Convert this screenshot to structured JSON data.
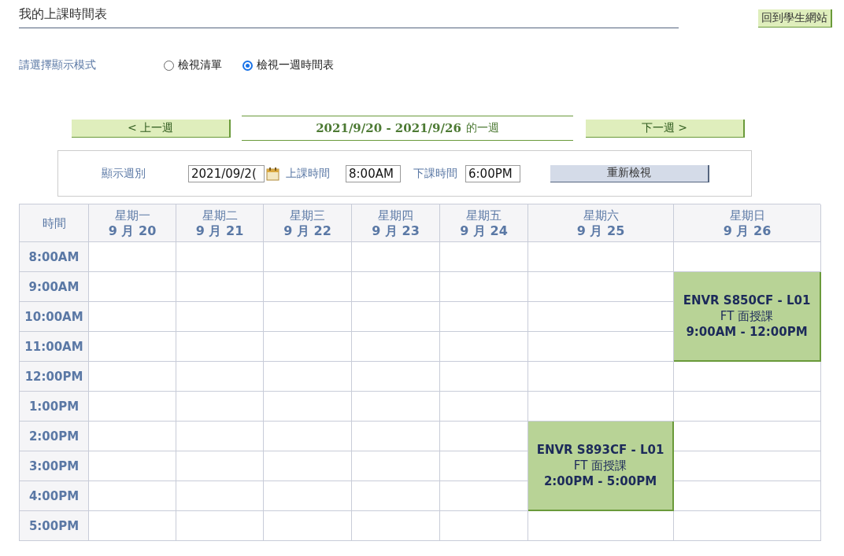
{
  "page_title": "我的上課時間表",
  "back_link": "回到學生網站",
  "mode": {
    "label": "請選擇顯示模式",
    "options": [
      {
        "label": "檢視清單",
        "selected": false
      },
      {
        "label": "檢視一週時間表",
        "selected": true
      }
    ]
  },
  "week_nav": {
    "prev": "< 上一週",
    "range": "2021/9/20 - 2021/9/26",
    "suffix": "的一週",
    "next": "下一週 >"
  },
  "filter": {
    "week_label": "顯示週別",
    "week_value": "2021/09/2(",
    "start_label": "上課時間",
    "start_value": "8:00AM",
    "end_label": "下課時間",
    "end_value": "6:00PM",
    "refresh": "重新檢視"
  },
  "table": {
    "time_header": "時間",
    "times": [
      "8:00AM",
      "9:00AM",
      "10:00AM",
      "11:00AM",
      "12:00PM",
      "1:00PM",
      "2:00PM",
      "3:00PM",
      "4:00PM",
      "5:00PM"
    ],
    "days": [
      {
        "weekday": "星期一",
        "date": "9 月 20",
        "slots": [
          {
            "kind": "free"
          },
          {
            "kind": "free"
          },
          {
            "kind": "free"
          },
          {
            "kind": "free"
          },
          {
            "kind": "free"
          },
          {
            "kind": "free"
          },
          {
            "kind": "free"
          },
          {
            "kind": "free"
          },
          {
            "kind": "free"
          },
          {
            "kind": "free"
          }
        ]
      },
      {
        "weekday": "星期二",
        "date": "9 月 21",
        "slots": [
          {
            "kind": "free"
          },
          {
            "kind": "free"
          },
          {
            "kind": "free"
          },
          {
            "kind": "free"
          },
          {
            "kind": "free"
          },
          {
            "kind": "free"
          },
          {
            "kind": "free"
          },
          {
            "kind": "free"
          },
          {
            "kind": "free"
          },
          {
            "kind": "free"
          }
        ]
      },
      {
        "weekday": "星期三",
        "date": "9 月 22",
        "slots": [
          {
            "kind": "free"
          },
          {
            "kind": "free"
          },
          {
            "kind": "free"
          },
          {
            "kind": "free"
          },
          {
            "kind": "free"
          },
          {
            "kind": "free"
          },
          {
            "kind": "free"
          },
          {
            "kind": "free"
          },
          {
            "kind": "free"
          },
          {
            "kind": "free"
          }
        ]
      },
      {
        "weekday": "星期四",
        "date": "9 月 23",
        "slots": [
          {
            "kind": "free"
          },
          {
            "kind": "free"
          },
          {
            "kind": "free"
          },
          {
            "kind": "free"
          },
          {
            "kind": "free"
          },
          {
            "kind": "free"
          },
          {
            "kind": "free"
          },
          {
            "kind": "free"
          },
          {
            "kind": "free"
          },
          {
            "kind": "free"
          }
        ]
      },
      {
        "weekday": "星期五",
        "date": "9 月 24",
        "slots": [
          {
            "kind": "free"
          },
          {
            "kind": "free"
          },
          {
            "kind": "free"
          },
          {
            "kind": "free"
          },
          {
            "kind": "free"
          },
          {
            "kind": "free"
          },
          {
            "kind": "free"
          },
          {
            "kind": "free"
          },
          {
            "kind": "free"
          },
          {
            "kind": "free"
          }
        ]
      },
      {
        "weekday": "星期六",
        "date": "9 月 25",
        "slots": [
          {
            "kind": "free"
          },
          {
            "kind": "free"
          },
          {
            "kind": "free"
          },
          {
            "kind": "free"
          },
          {
            "kind": "free"
          },
          {
            "kind": "free"
          },
          {
            "kind": "class",
            "course": "ENVR S893CF - L01",
            "mode": "FT 面授課",
            "time": "2:00PM - 5:00PM"
          },
          {
            "kind": "cont"
          },
          {
            "kind": "cont"
          },
          {
            "kind": "free"
          }
        ]
      },
      {
        "weekday": "星期日",
        "date": "9 月 26",
        "slots": [
          {
            "kind": "free"
          },
          {
            "kind": "class",
            "course": "ENVR S850CF - L01",
            "mode": "FT 面授課",
            "time": "9:00AM - 12:00PM"
          },
          {
            "kind": "cont"
          },
          {
            "kind": "cont"
          },
          {
            "kind": "free"
          },
          {
            "kind": "free"
          },
          {
            "kind": "free"
          },
          {
            "kind": "free"
          },
          {
            "kind": "free"
          },
          {
            "kind": "free"
          }
        ]
      }
    ]
  }
}
